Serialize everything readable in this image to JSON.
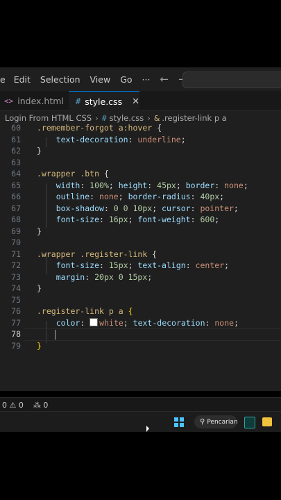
{
  "menu": {
    "items": [
      "e",
      "Edit",
      "Selection",
      "View",
      "Go"
    ],
    "more": "···",
    "back": "←",
    "forward": "→"
  },
  "tabs": [
    {
      "icon": "<>",
      "label": "index.html"
    },
    {
      "icon": "#",
      "label": "style.css",
      "close": "✕"
    }
  ],
  "breadcrumb": {
    "folder": "Login From HTML CSS",
    "file_icon": "#",
    "file": "style.css",
    "symbol": ".register-link p a"
  },
  "editor": {
    "current_line": 78,
    "lines": [
      {
        "n": "60",
        "tokens": [
          {
            "t": ".remember-forgot a:hover",
            "c": "sel"
          },
          {
            "t": " {",
            "c": "pun"
          }
        ]
      },
      {
        "n": "61",
        "tokens": [
          {
            "t": "    text-decoration",
            "c": "prop"
          },
          {
            "t": ": ",
            "c": "pun"
          },
          {
            "t": "underline",
            "c": "val"
          },
          {
            "t": ";",
            "c": "pun"
          }
        ]
      },
      {
        "n": "62",
        "tokens": [
          {
            "t": "}",
            "c": "pun"
          }
        ]
      },
      {
        "n": "63",
        "tokens": []
      },
      {
        "n": "64",
        "tokens": [
          {
            "t": ".wrapper .btn",
            "c": "sel"
          },
          {
            "t": " {",
            "c": "pun"
          }
        ]
      },
      {
        "n": "65",
        "tokens": [
          {
            "t": "    width",
            "c": "prop"
          },
          {
            "t": ": ",
            "c": "pun"
          },
          {
            "t": "100%",
            "c": "num"
          },
          {
            "t": "; ",
            "c": "pun"
          },
          {
            "t": "height",
            "c": "prop"
          },
          {
            "t": ": ",
            "c": "pun"
          },
          {
            "t": "45px",
            "c": "num"
          },
          {
            "t": "; ",
            "c": "pun"
          },
          {
            "t": "border",
            "c": "prop"
          },
          {
            "t": ": ",
            "c": "pun"
          },
          {
            "t": "none",
            "c": "val"
          },
          {
            "t": ";",
            "c": "pun"
          }
        ]
      },
      {
        "n": "66",
        "tokens": [
          {
            "t": "    outline",
            "c": "prop"
          },
          {
            "t": ": ",
            "c": "pun"
          },
          {
            "t": "none",
            "c": "val"
          },
          {
            "t": "; ",
            "c": "pun"
          },
          {
            "t": "border-radius",
            "c": "prop"
          },
          {
            "t": ": ",
            "c": "pun"
          },
          {
            "t": "40px",
            "c": "num"
          },
          {
            "t": ";",
            "c": "pun"
          }
        ]
      },
      {
        "n": "67",
        "tokens": [
          {
            "t": "    box-shadow",
            "c": "prop"
          },
          {
            "t": ": ",
            "c": "pun"
          },
          {
            "t": "0 0 10px",
            "c": "num"
          },
          {
            "t": "; ",
            "c": "pun"
          },
          {
            "t": "cursor",
            "c": "prop"
          },
          {
            "t": ": ",
            "c": "pun"
          },
          {
            "t": "pointer",
            "c": "val"
          },
          {
            "t": ";",
            "c": "pun"
          }
        ]
      },
      {
        "n": "68",
        "tokens": [
          {
            "t": "    font-size",
            "c": "prop"
          },
          {
            "t": ": ",
            "c": "pun"
          },
          {
            "t": "16px",
            "c": "num"
          },
          {
            "t": "; ",
            "c": "pun"
          },
          {
            "t": "font-weight",
            "c": "prop"
          },
          {
            "t": ": ",
            "c": "pun"
          },
          {
            "t": "600",
            "c": "num"
          },
          {
            "t": ";",
            "c": "pun"
          }
        ]
      },
      {
        "n": "69",
        "tokens": [
          {
            "t": "}",
            "c": "pun"
          }
        ]
      },
      {
        "n": "70",
        "tokens": []
      },
      {
        "n": "71",
        "tokens": [
          {
            "t": ".wrapper .register-link",
            "c": "sel"
          },
          {
            "t": " {",
            "c": "pun"
          }
        ]
      },
      {
        "n": "72",
        "tokens": [
          {
            "t": "    font-size",
            "c": "prop"
          },
          {
            "t": ": ",
            "c": "pun"
          },
          {
            "t": "15px",
            "c": "num"
          },
          {
            "t": "; ",
            "c": "pun"
          },
          {
            "t": "text-align",
            "c": "prop"
          },
          {
            "t": ": ",
            "c": "pun"
          },
          {
            "t": "center",
            "c": "val"
          },
          {
            "t": ";",
            "c": "pun"
          }
        ]
      },
      {
        "n": "73",
        "tokens": [
          {
            "t": "    margin",
            "c": "prop"
          },
          {
            "t": ": ",
            "c": "pun"
          },
          {
            "t": "20px 0 15px",
            "c": "num"
          },
          {
            "t": ";",
            "c": "pun"
          }
        ]
      },
      {
        "n": "74",
        "tokens": [
          {
            "t": "}",
            "c": "pun"
          }
        ]
      },
      {
        "n": "75",
        "tokens": []
      },
      {
        "n": "76",
        "tokens": [
          {
            "t": ".register-link p a",
            "c": "sel"
          },
          {
            "t": " ",
            "c": "pun"
          },
          {
            "t": "{",
            "c": "brace"
          }
        ]
      },
      {
        "n": "77",
        "tokens": [
          {
            "t": "    color",
            "c": "prop"
          },
          {
            "t": ": ",
            "c": "pun"
          },
          {
            "t": "",
            "c": "swatch"
          },
          {
            "t": "white",
            "c": "val"
          },
          {
            "t": "; ",
            "c": "pun"
          },
          {
            "t": "text-decoration",
            "c": "prop"
          },
          {
            "t": ": ",
            "c": "pun"
          },
          {
            "t": "none",
            "c": "val"
          },
          {
            "t": ";",
            "c": "pun"
          }
        ]
      },
      {
        "n": "78",
        "tokens": []
      },
      {
        "n": "79",
        "tokens": [
          {
            "t": "}",
            "c": "brace"
          }
        ]
      }
    ]
  },
  "status": {
    "errors": "0",
    "warnings": "0",
    "ports": "0"
  },
  "taskbar": {
    "search_label": "Pencarian"
  },
  "colors": {
    "editor_bg": "#1f1f1f",
    "accent": "#0078d4",
    "selector": "#d7ba7d",
    "property": "#9cdcfe",
    "string": "#ce9178",
    "number": "#b5cea8"
  }
}
